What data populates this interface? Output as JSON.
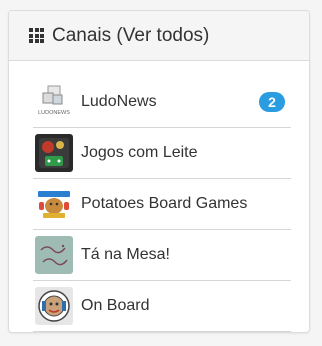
{
  "panel": {
    "title": "Canais (Ver todos)",
    "icon": "grid-icon"
  },
  "channels": [
    {
      "label": "LudoNews",
      "badge": "2",
      "logo_text": "LUDONEWS",
      "icon": "ludonews-logo"
    },
    {
      "label": "Jogos com Leite",
      "badge": null,
      "icon": "jogos-com-leite-logo"
    },
    {
      "label": "Potatoes Board Games",
      "badge": null,
      "icon": "potatoes-board-games-logo"
    },
    {
      "label": "Tá na Mesa!",
      "badge": null,
      "icon": "ta-na-mesa-logo"
    },
    {
      "label": "On Board",
      "badge": null,
      "icon": "on-board-logo"
    }
  ],
  "colors": {
    "badge": "#2a9de0",
    "header_bg": "#f5f5f5",
    "border": "#dcdcdc"
  }
}
